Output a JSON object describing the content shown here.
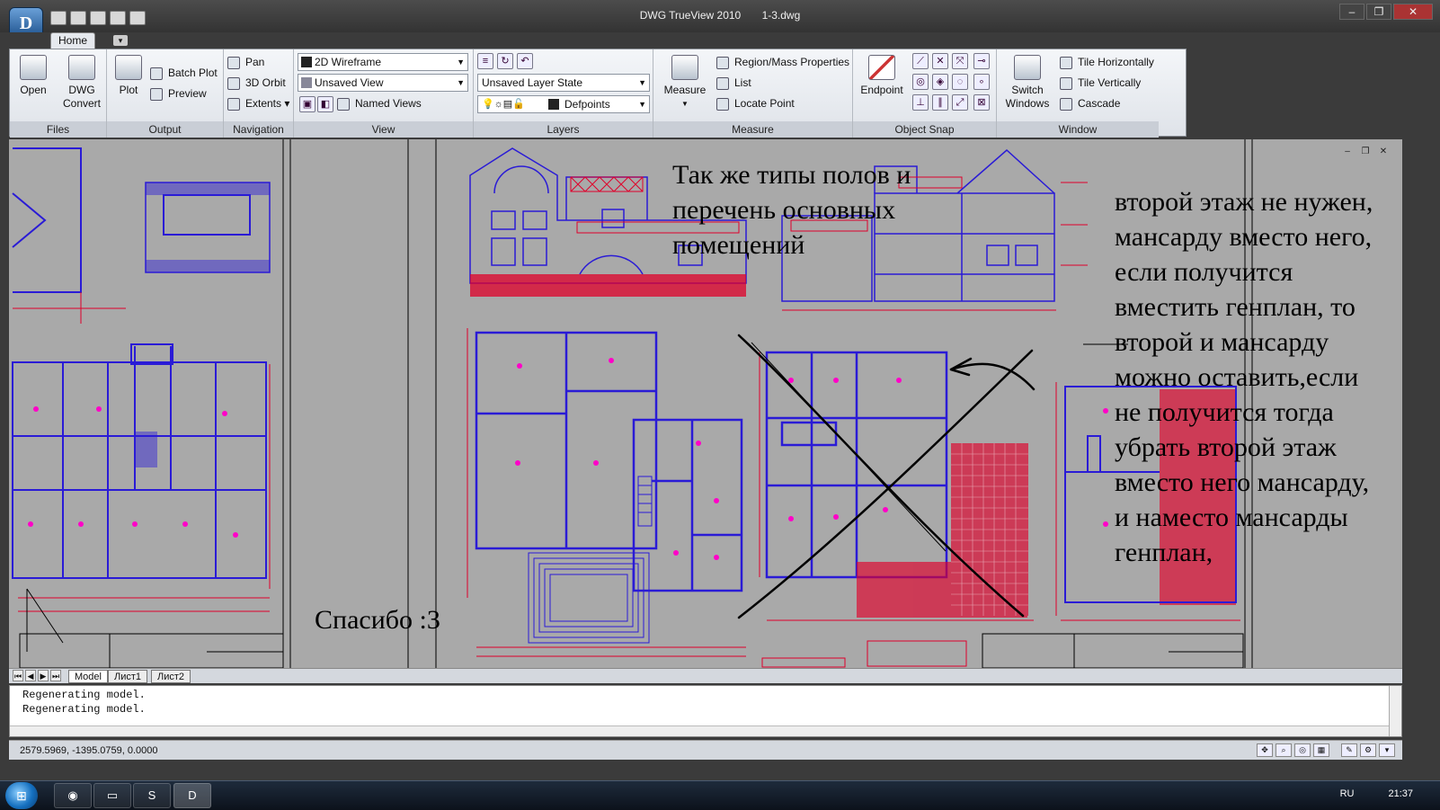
{
  "titlebar": {
    "app": "DWG TrueView 2010",
    "file": "1-3.dwg",
    "app_button": "D",
    "controls": [
      "–",
      "❐",
      "✕"
    ]
  },
  "tabs": {
    "home": "Home"
  },
  "ribbon": {
    "files": {
      "title": "Files",
      "open": "Open",
      "dwg_convert_1": "DWG",
      "dwg_convert_2": "Convert"
    },
    "output": {
      "title": "Output",
      "plot": "Plot",
      "batch_plot": "Batch Plot",
      "preview": "Preview"
    },
    "navigation": {
      "title": "Navigation",
      "pan": "Pan",
      "orbit": "3D Orbit",
      "extents": "Extents"
    },
    "view": {
      "title": "View",
      "visual_style": "2D Wireframe",
      "saved_view": "Unsaved View",
      "named_views": "Named Views"
    },
    "layers": {
      "title": "Layers",
      "layer_state": "Unsaved Layer State",
      "layer": "Defpoints"
    },
    "measure": {
      "title": "Measure",
      "measure": "Measure",
      "region_mass": "Region/Mass Properties",
      "list": "List",
      "locate_point": "Locate Point"
    },
    "object_snap": {
      "title": "Object Snap",
      "endpoint": "Endpoint"
    },
    "window": {
      "title": "Window",
      "switch_1": "Switch",
      "switch_2": "Windows",
      "tile_h": "Tile Horizontally",
      "tile_v": "Tile Vertically",
      "cascade": "Cascade"
    }
  },
  "drawing": {
    "note_top": "Так же типы полов и перечень основных помещений",
    "note_right": "второй этаж не нужен, мансарду вместо него, если получится вместить генплан, то второй и мансарду можно оставить,если не получится тогда убрать второй этаж вместо него мансарду, и наместо мансарды генплан,",
    "note_thanks": "Спасибо :3",
    "colors": {
      "background": "#a9a9a9",
      "plan_lines": "#2a1bd6",
      "dimensions": "#e0002a",
      "labels": "#ff00c8",
      "handwriting": "#000000"
    }
  },
  "layout_tabs": [
    "Model",
    "Лист1",
    "Лист2"
  ],
  "command_lines": [
    "Regenerating model.",
    "Regenerating model."
  ],
  "status": {
    "coordinates": "2579.5969, -1395.0759, 0.0000"
  },
  "taskbar": {
    "language": "RU",
    "clock": "21:37"
  }
}
